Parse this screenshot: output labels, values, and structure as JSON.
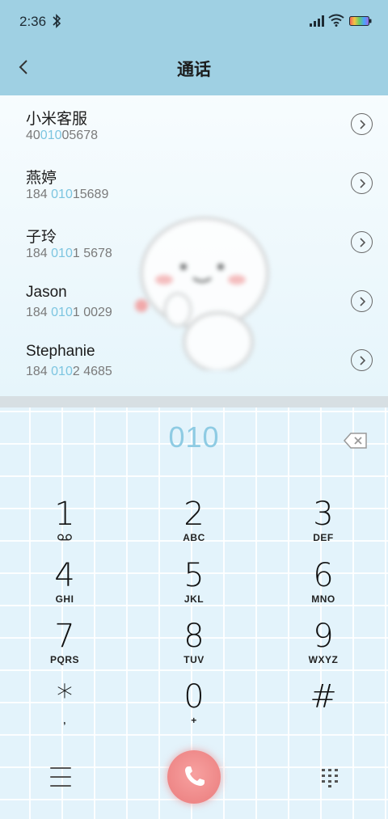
{
  "status_bar": {
    "time": "2:36"
  },
  "header": {
    "title": "通话"
  },
  "contacts": [
    {
      "name": "小米客服",
      "num_pre": "40",
      "num_hl": "010",
      "num_post": "05678"
    },
    {
      "name": "燕婷",
      "num_pre": "184 ",
      "num_hl": "010",
      "num_post": "15689"
    },
    {
      "name": "子玲",
      "num_pre": "184 ",
      "num_hl": "010",
      "num_post": "1 5678"
    },
    {
      "name": "Jason",
      "num_pre": "184 ",
      "num_hl": "010",
      "num_post": "1 0029"
    },
    {
      "name": "Stephanie",
      "num_pre": "184 ",
      "num_hl": "010",
      "num_post": "2 4685"
    }
  ],
  "dialer": {
    "input": "010",
    "keys": [
      {
        "digit": "1",
        "letters": ""
      },
      {
        "digit": "2",
        "letters": "ABC"
      },
      {
        "digit": "3",
        "letters": "DEF"
      },
      {
        "digit": "4",
        "letters": "GHI"
      },
      {
        "digit": "5",
        "letters": "JKL"
      },
      {
        "digit": "6",
        "letters": "MNO"
      },
      {
        "digit": "7",
        "letters": "PQRS"
      },
      {
        "digit": "8",
        "letters": "TUV"
      },
      {
        "digit": "9",
        "letters": "WXYZ"
      },
      {
        "digit": "*",
        "letters": ","
      },
      {
        "digit": "0",
        "letters": "+"
      },
      {
        "digit": "#",
        "letters": ""
      }
    ]
  },
  "colors": {
    "header_bg": "#9fd0e3",
    "highlight": "#7cc5e0",
    "call_button": "#ee8787"
  },
  "icons": {
    "voicemail": "voicemail-icon",
    "back": "back-arrow-icon",
    "backspace": "backspace-icon",
    "call": "phone-icon"
  }
}
